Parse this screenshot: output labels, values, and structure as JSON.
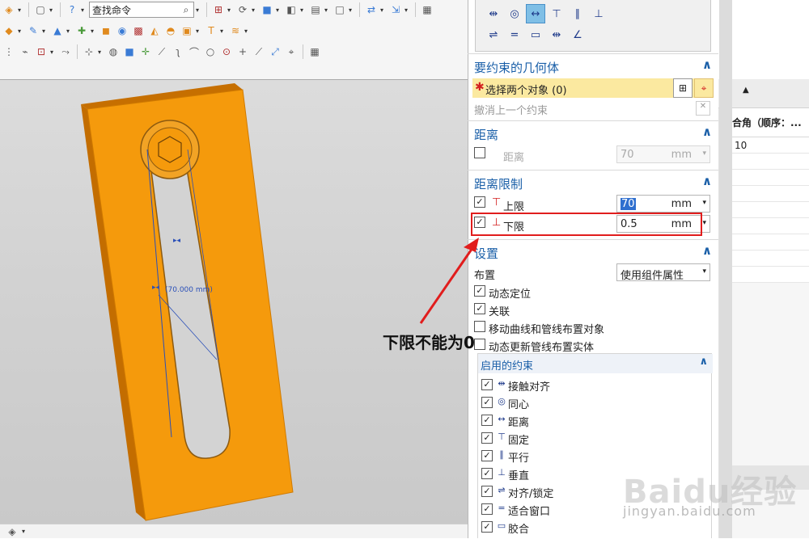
{
  "toolbar": {
    "command_search_placeholder": "查找命令"
  },
  "viewport": {
    "dimension_label": "(70.000 mm)"
  },
  "background_list": {
    "column_header": "合角（顺序：...",
    "first_value": "10"
  },
  "dialog": {
    "sections": {
      "geometry": {
        "title": "要约束的几何体",
        "select_objects": "选择两个对象 (0)",
        "undo_last": "撤消上一个约束"
      },
      "distance": {
        "title": "距离",
        "label": "距离",
        "value": "70",
        "unit": "mm"
      },
      "distance_limits": {
        "title": "距离限制",
        "upper_label": "上限",
        "upper_value": "70",
        "upper_unit": "mm",
        "lower_label": "下限",
        "lower_value": "0.5",
        "lower_unit": "mm"
      },
      "settings": {
        "title": "设置",
        "layout_label": "布置",
        "layout_value": "使用组件属性",
        "dynamic_positioning": "动态定位",
        "associative": "关联",
        "move_curves": "移动曲线和管线布置对象",
        "dynamic_update": "动态更新管线布置实体"
      },
      "enabled_constraints": {
        "title": "启用的约束",
        "items": [
          {
            "label": "接触对齐",
            "icon": "touch-align-icon"
          },
          {
            "label": "同心",
            "icon": "concentric-icon"
          },
          {
            "label": "距离",
            "icon": "distance-icon"
          },
          {
            "label": "固定",
            "icon": "fix-icon"
          },
          {
            "label": "平行",
            "icon": "parallel-icon"
          },
          {
            "label": "垂直",
            "icon": "perpendicular-icon"
          },
          {
            "label": "对齐/锁定",
            "icon": "align-lock-icon"
          },
          {
            "label": "适合窗口",
            "icon": "fit-icon"
          },
          {
            "label": "胶合",
            "icon": "bond-icon"
          }
        ]
      }
    }
  },
  "annotation": {
    "text": "下限不能为0",
    "color": "#e11d1d"
  },
  "watermark": {
    "brand": "Baidu经验",
    "url": "jingyan.baidu.com"
  },
  "colors": {
    "part_orange": "#f59a0c",
    "accent_blue": "#1a5fa8",
    "select_highlight": "#fbe9a0"
  }
}
